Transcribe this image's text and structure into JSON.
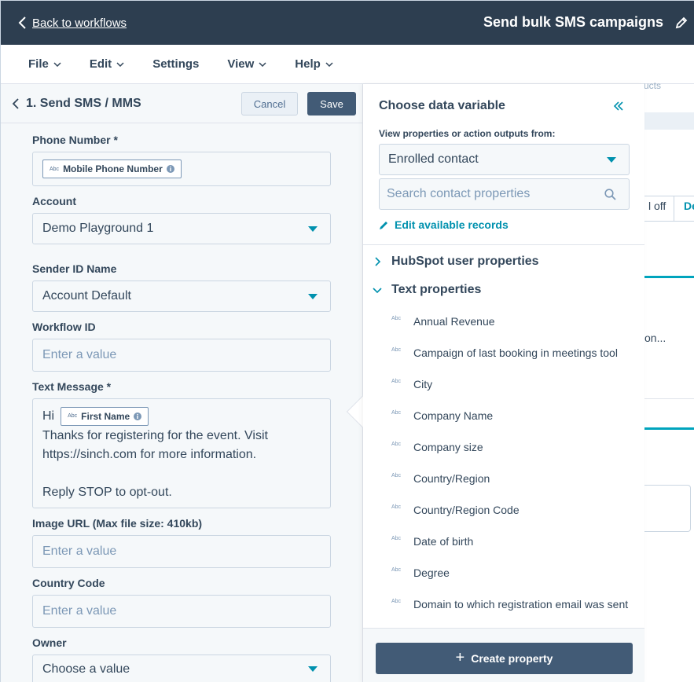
{
  "header": {
    "back_label": "Back to workflows",
    "workflow_title": "Send bulk SMS campaigns"
  },
  "menu": {
    "items": [
      {
        "label": "File",
        "has_caret": true
      },
      {
        "label": "Edit",
        "has_caret": true
      },
      {
        "label": "Settings",
        "has_caret": false
      },
      {
        "label": "View",
        "has_caret": true
      },
      {
        "label": "Help",
        "has_caret": true
      }
    ]
  },
  "action": {
    "title": "1. Send SMS / MMS",
    "cancel_label": "Cancel",
    "save_label": "Save",
    "fields": {
      "phone_label": "Phone Number *",
      "phone_token": "Mobile Phone Number",
      "account_label": "Account",
      "account_value": "Demo Playground 1",
      "sender_label": "Sender ID Name",
      "sender_value": "Account Default",
      "workflow_label": "Workflow ID",
      "workflow_placeholder": "Enter a value",
      "message_label": "Text Message *",
      "message_hi": "Hi",
      "message_token": "First Name",
      "message_line2": "Thanks for registering for the event. Visit",
      "message_line3": "https://sinch.com for more information.",
      "message_line5": "Reply STOP to opt-out.",
      "image_label": "Image URL (Max file size: 410kb)",
      "image_placeholder": "Enter a value",
      "country_label": "Country Code",
      "country_placeholder": "Enter a value",
      "owner_label": "Owner",
      "owner_placeholder": "Choose a value"
    },
    "token_type": "Abc"
  },
  "data_variable": {
    "title": "Choose data variable",
    "subtitle": "View properties or action outputs from:",
    "source_value": "Enrolled contact",
    "search_placeholder": "Search contact properties",
    "edit_records_label": "Edit available records",
    "groups": [
      {
        "label": "HubSpot user properties",
        "expanded": false
      },
      {
        "label": "Text properties",
        "expanded": true
      }
    ],
    "type_tag": "Abc",
    "properties": [
      "Annual Revenue",
      "Campaign of last booking in meetings tool",
      "City",
      "Company Name",
      "Company size",
      "Country/Region",
      "Country/Region Code",
      "Date of birth",
      "Degree",
      "Domain to which registration email was sent"
    ],
    "create_label": "Create property"
  },
  "background": {
    "frag1": "l off",
    "frag2": "De",
    "frag3": "on...",
    "frag4": "ucts"
  },
  "colors": {
    "header_bg": "#2d3e50",
    "accent": "#0091ae",
    "primary_button": "#425b76"
  }
}
